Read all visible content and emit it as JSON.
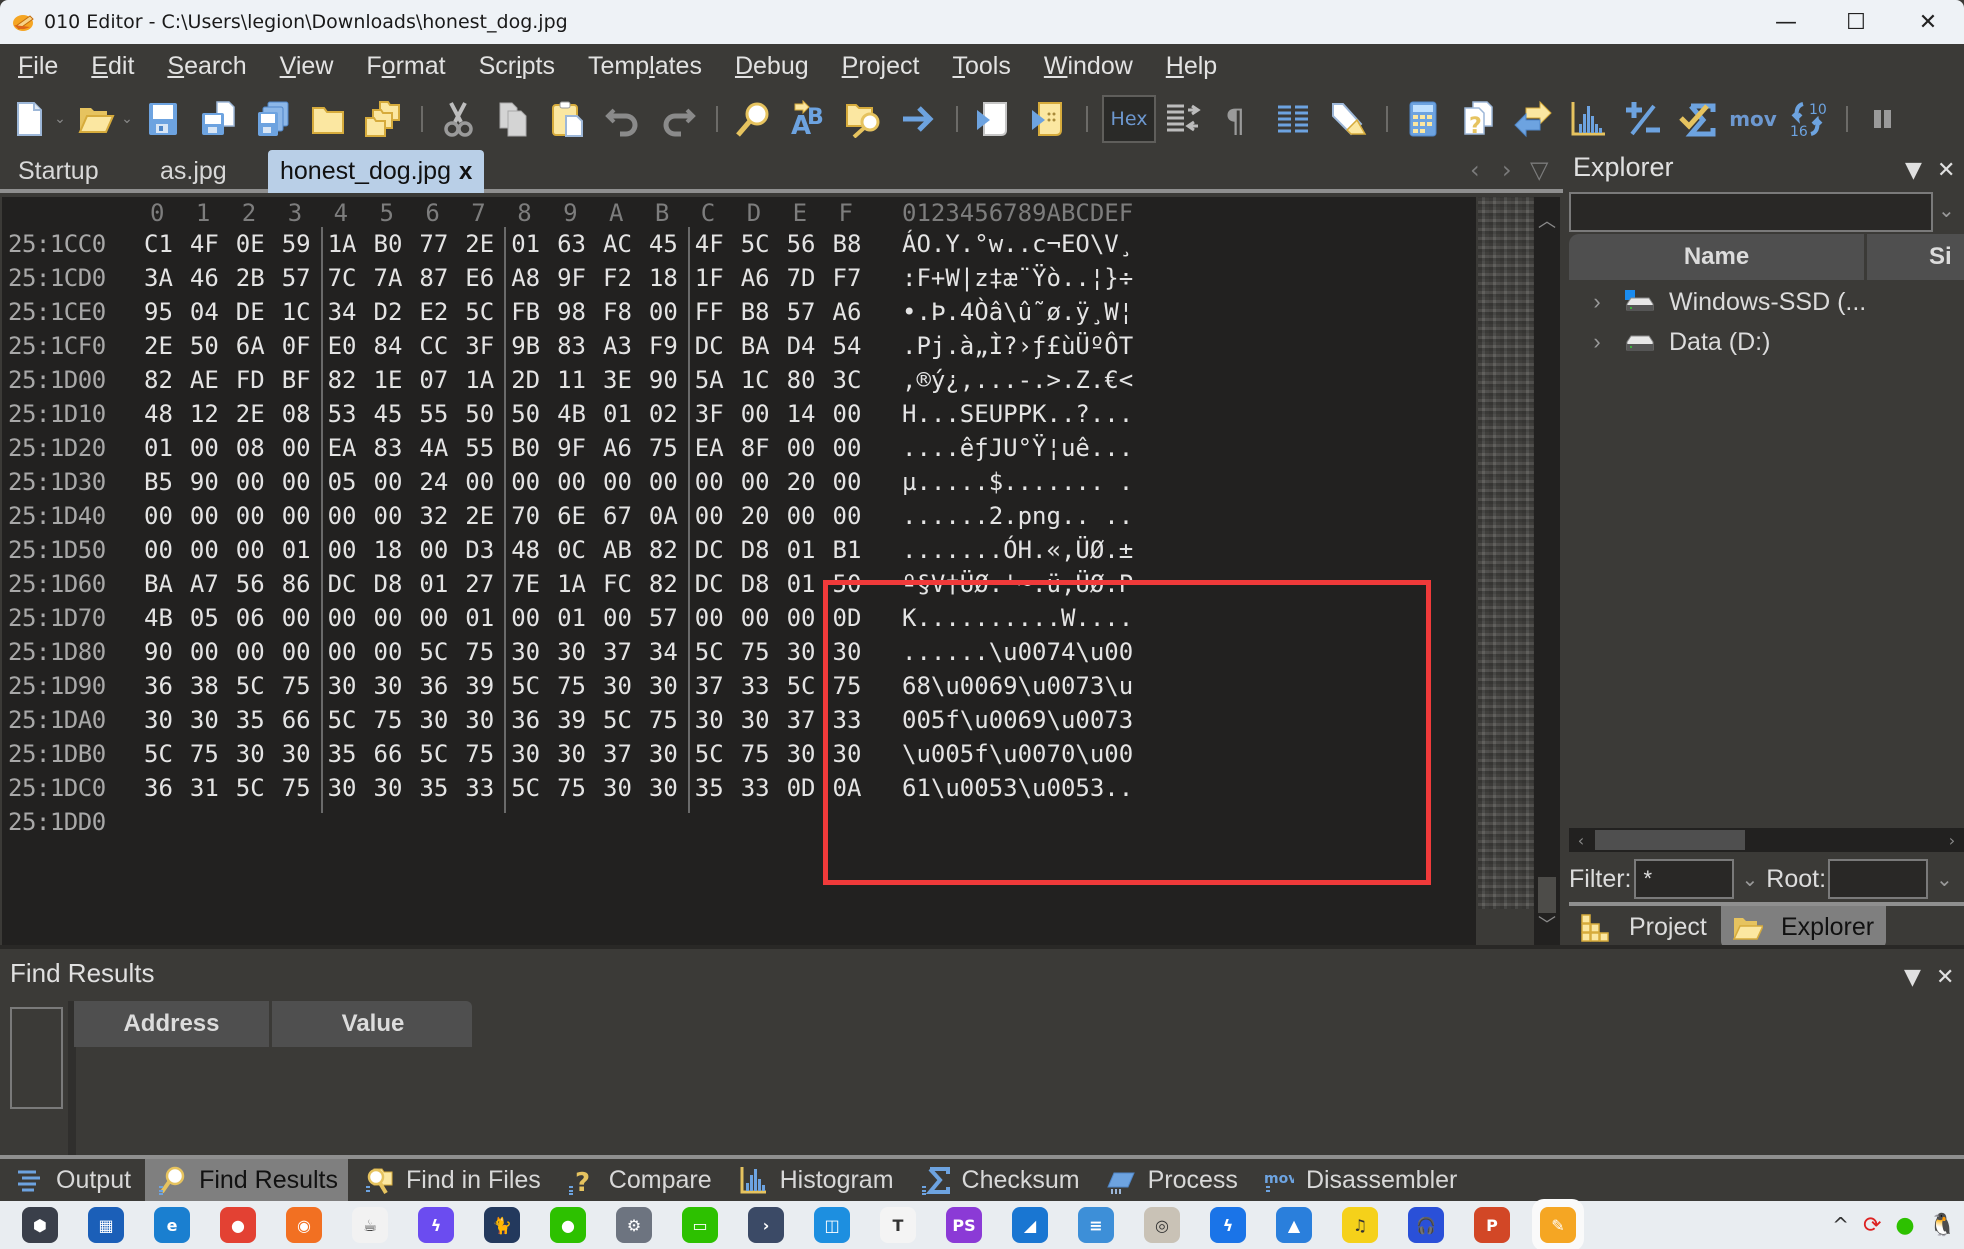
{
  "window": {
    "title": "010 Editor - C:\\Users\\legion\\Downloads\\honest_dog.jpg",
    "controls": {
      "minimize": "—",
      "maximize": "☐",
      "close": "✕"
    }
  },
  "menu": [
    {
      "label": "File",
      "accel": "F"
    },
    {
      "label": "Edit",
      "accel": "E"
    },
    {
      "label": "Search",
      "accel": "S"
    },
    {
      "label": "View",
      "accel": "V"
    },
    {
      "label": "Format",
      "accel": "o"
    },
    {
      "label": "Scripts",
      "accel": "i"
    },
    {
      "label": "Templates",
      "accel": "l"
    },
    {
      "label": "Debug",
      "accel": "D"
    },
    {
      "label": "Project",
      "accel": "P"
    },
    {
      "label": "Tools",
      "accel": "T"
    },
    {
      "label": "Window",
      "accel": "W"
    },
    {
      "label": "Help",
      "accel": "H"
    }
  ],
  "toolbar": {
    "hex_label": "Hex",
    "mov_label": "mov",
    "convert_top": "10",
    "convert_bottom": "16",
    "buttons": [
      "new-file",
      "open-file",
      "save",
      "save-as",
      "save-all",
      "open-folder",
      "open-workspace",
      "cut",
      "copy",
      "paste",
      "undo",
      "redo",
      "find",
      "replace",
      "find-in-files",
      "goto",
      "run-script",
      "run-template",
      "hex-mode",
      "columns",
      "show-whitespace",
      "line-width",
      "highlight",
      "calculator",
      "compare",
      "swap",
      "histogram",
      "checksum-plus-minus",
      "checksum",
      "disassembler",
      "base-convert",
      "pause"
    ]
  },
  "tabs": [
    {
      "label": "Startup",
      "active": false
    },
    {
      "label": "as.jpg",
      "active": false
    },
    {
      "label": "honest_dog.jpg",
      "active": true,
      "close": "x"
    }
  ],
  "tab_nav": {
    "prev": "‹",
    "next": "›",
    "list": "▽"
  },
  "hex": {
    "column_headers": [
      "0",
      "1",
      "2",
      "3",
      "4",
      "5",
      "6",
      "7",
      "8",
      "9",
      "A",
      "B",
      "C",
      "D",
      "E",
      "F"
    ],
    "ascii_header": "0123456789ABCDEF",
    "rows": [
      {
        "addr": "25:1CC0",
        "bytes": [
          "C1",
          "4F",
          "0E",
          "59",
          "1A",
          "B0",
          "77",
          "2E",
          "01",
          "63",
          "AC",
          "45",
          "4F",
          "5C",
          "56",
          "B8"
        ],
        "ascii": "ÁO.Y.°w..c¬EO\\V¸"
      },
      {
        "addr": "25:1CD0",
        "bytes": [
          "3A",
          "46",
          "2B",
          "57",
          "7C",
          "7A",
          "87",
          "E6",
          "A8",
          "9F",
          "F2",
          "18",
          "1F",
          "A6",
          "7D",
          "F7"
        ],
        "ascii": ":F+W|z‡æ¨Ÿò..¦}÷"
      },
      {
        "addr": "25:1CE0",
        "bytes": [
          "95",
          "04",
          "DE",
          "1C",
          "34",
          "D2",
          "E2",
          "5C",
          "FB",
          "98",
          "F8",
          "00",
          "FF",
          "B8",
          "57",
          "A6"
        ],
        "ascii": "•.Þ.4Òâ\\û˜ø.ÿ¸W¦"
      },
      {
        "addr": "25:1CF0",
        "bytes": [
          "2E",
          "50",
          "6A",
          "0F",
          "E0",
          "84",
          "CC",
          "3F",
          "9B",
          "83",
          "A3",
          "F9",
          "DC",
          "BA",
          "D4",
          "54"
        ],
        "ascii": ".Pj.à„Ì?›ƒ£ùÜºÔT"
      },
      {
        "addr": "25:1D00",
        "bytes": [
          "82",
          "AE",
          "FD",
          "BF",
          "82",
          "1E",
          "07",
          "1A",
          "2D",
          "11",
          "3E",
          "90",
          "5A",
          "1C",
          "80",
          "3C"
        ],
        "ascii": "‚®ý¿‚...-.>.Z.€<"
      },
      {
        "addr": "25:1D10",
        "bytes": [
          "48",
          "12",
          "2E",
          "08",
          "53",
          "45",
          "55",
          "50",
          "50",
          "4B",
          "01",
          "02",
          "3F",
          "00",
          "14",
          "00"
        ],
        "ascii": "H...SEUPPK..?..."
      },
      {
        "addr": "25:1D20",
        "bytes": [
          "01",
          "00",
          "08",
          "00",
          "EA",
          "83",
          "4A",
          "55",
          "B0",
          "9F",
          "A6",
          "75",
          "EA",
          "8F",
          "00",
          "00"
        ],
        "ascii": "....êƒJU°Ÿ¦uê..."
      },
      {
        "addr": "25:1D30",
        "bytes": [
          "B5",
          "90",
          "00",
          "00",
          "05",
          "00",
          "24",
          "00",
          "00",
          "00",
          "00",
          "00",
          "00",
          "00",
          "20",
          "00"
        ],
        "ascii": "µ.....$....... ."
      },
      {
        "addr": "25:1D40",
        "bytes": [
          "00",
          "00",
          "00",
          "00",
          "00",
          "00",
          "32",
          "2E",
          "70",
          "6E",
          "67",
          "0A",
          "00",
          "20",
          "00",
          "00"
        ],
        "ascii": "......2.png.. .."
      },
      {
        "addr": "25:1D50",
        "bytes": [
          "00",
          "00",
          "00",
          "01",
          "00",
          "18",
          "00",
          "D3",
          "48",
          "0C",
          "AB",
          "82",
          "DC",
          "D8",
          "01",
          "B1"
        ],
        "ascii": ".......ÓH.«‚ÜØ.±"
      },
      {
        "addr": "25:1D60",
        "bytes": [
          "BA",
          "A7",
          "56",
          "86",
          "DC",
          "D8",
          "01",
          "27",
          "7E",
          "1A",
          "FC",
          "82",
          "DC",
          "D8",
          "01",
          "50"
        ],
        "ascii": "º§V†ÜØ.'~.ü‚ÜØ.P"
      },
      {
        "addr": "25:1D70",
        "bytes": [
          "4B",
          "05",
          "06",
          "00",
          "00",
          "00",
          "00",
          "01",
          "00",
          "01",
          "00",
          "57",
          "00",
          "00",
          "00",
          "0D"
        ],
        "ascii": "K..........W...."
      },
      {
        "addr": "25:1D80",
        "bytes": [
          "90",
          "00",
          "00",
          "00",
          "00",
          "00",
          "5C",
          "75",
          "30",
          "30",
          "37",
          "34",
          "5C",
          "75",
          "30",
          "30"
        ],
        "ascii": "......\\u0074\\u00"
      },
      {
        "addr": "25:1D90",
        "bytes": [
          "36",
          "38",
          "5C",
          "75",
          "30",
          "30",
          "36",
          "39",
          "5C",
          "75",
          "30",
          "30",
          "37",
          "33",
          "5C",
          "75"
        ],
        "ascii": "68\\u0069\\u0073\\u"
      },
      {
        "addr": "25:1DA0",
        "bytes": [
          "30",
          "30",
          "35",
          "66",
          "5C",
          "75",
          "30",
          "30",
          "36",
          "39",
          "5C",
          "75",
          "30",
          "30",
          "37",
          "33"
        ],
        "ascii": "005f\\u0069\\u0073"
      },
      {
        "addr": "25:1DB0",
        "bytes": [
          "5C",
          "75",
          "30",
          "30",
          "35",
          "66",
          "5C",
          "75",
          "30",
          "30",
          "37",
          "30",
          "5C",
          "75",
          "30",
          "30"
        ],
        "ascii": "\\u005f\\u0070\\u00"
      },
      {
        "addr": "25:1DC0",
        "bytes": [
          "36",
          "31",
          "5C",
          "75",
          "30",
          "30",
          "35",
          "33",
          "5C",
          "75",
          "30",
          "30",
          "35",
          "33",
          "0D",
          "0A"
        ],
        "ascii": "61\\u0053\\u0053.."
      },
      {
        "addr": "25:1DD0",
        "bytes": [],
        "ascii": ""
      }
    ],
    "highlight_color": "#f03a3a"
  },
  "explorer": {
    "title": "Explorer",
    "menu_glyph": "▼",
    "close_glyph": "✕",
    "path_value": "",
    "columns": [
      "Name",
      "Si"
    ],
    "items": [
      {
        "label": "Windows-SSD (...",
        "icon": "windows-drive-icon"
      },
      {
        "label": "Data (D:)",
        "icon": "drive-icon"
      }
    ],
    "filter_label": "Filter:",
    "filter_value": "*",
    "root_label": "Root:",
    "root_value": "",
    "tabs": [
      {
        "label": "Project",
        "active": false
      },
      {
        "label": "Explorer",
        "active": true
      }
    ]
  },
  "find_results": {
    "title": "Find Results",
    "columns": [
      "Address",
      "Value"
    ],
    "menu_glyph": "▼",
    "close_glyph": "✕"
  },
  "bottom_tabs": [
    {
      "label": "Output",
      "icon": "output-icon",
      "active": false
    },
    {
      "label": "Find Results",
      "icon": "find-results-icon",
      "active": true
    },
    {
      "label": "Find in Files",
      "icon": "find-in-files-icon",
      "active": false
    },
    {
      "label": "Compare",
      "icon": "compare-icon",
      "active": false
    },
    {
      "label": "Histogram",
      "icon": "histogram-icon",
      "active": false
    },
    {
      "label": "Checksum",
      "icon": "checksum-icon",
      "active": false
    },
    {
      "label": "Process",
      "icon": "process-icon",
      "active": false
    },
    {
      "label": "Disassembler",
      "icon": "disassembler-icon",
      "active": false
    }
  ],
  "taskbar": {
    "apps": [
      "vmware-workstation",
      "microsoft-store",
      "edge",
      "chrome",
      "firefox",
      "java",
      "lightning-app",
      "cat-app",
      "wechat",
      "settings",
      "wechat-devtools",
      "powershell-arrow",
      "vmware",
      "typora",
      "phpstorm",
      "wireshark",
      "notepad",
      "photo-app",
      "thunder",
      "photos",
      "qq-music",
      "audacity",
      "powerpoint",
      "010-editor"
    ],
    "active_app": "010-editor",
    "tray": {
      "expand": "^"
    }
  }
}
